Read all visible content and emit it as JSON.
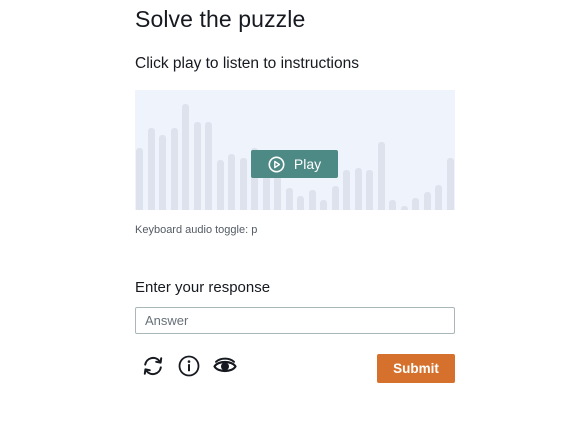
{
  "puzzle": {
    "title": "Solve the puzzle",
    "instructions": "Click play to listen to instructions",
    "play_label": "Play",
    "keyboard_hint": "Keyboard audio toggle: p"
  },
  "response": {
    "label": "Enter your response",
    "answer_value": "",
    "answer_placeholder": "Answer",
    "submit_label": "Submit"
  },
  "icons": {
    "refresh": "refresh-icon",
    "info": "info-icon",
    "visual": "eye-icon",
    "play": "play-circle-icon"
  },
  "colors": {
    "play_button": "#4e8a85",
    "submit_button": "#d5712c",
    "audio_background": "#eff3fc",
    "waveform_bar": "#dde2ec"
  }
}
